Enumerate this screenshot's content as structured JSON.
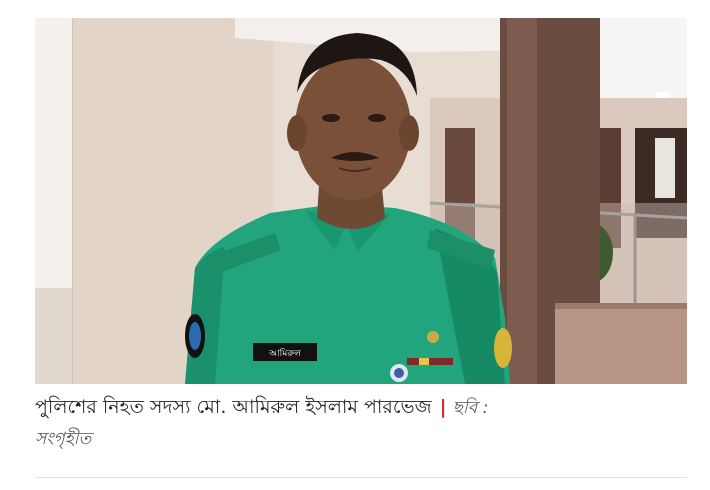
{
  "photo": {
    "subject": "police-officer-portrait",
    "name_tag": "আমিরুল",
    "colors": {
      "uniform": "#1fa37b",
      "wall": "#e9ddd2",
      "pillar": "#5a3e34"
    }
  },
  "caption": {
    "text": "পুলিশের নিহত সদস্য মো. আমিরুল ইসলাম পারভেজ",
    "separator": "|",
    "credit_label": "ছবি :",
    "credit_value": "সংগৃহীত"
  }
}
